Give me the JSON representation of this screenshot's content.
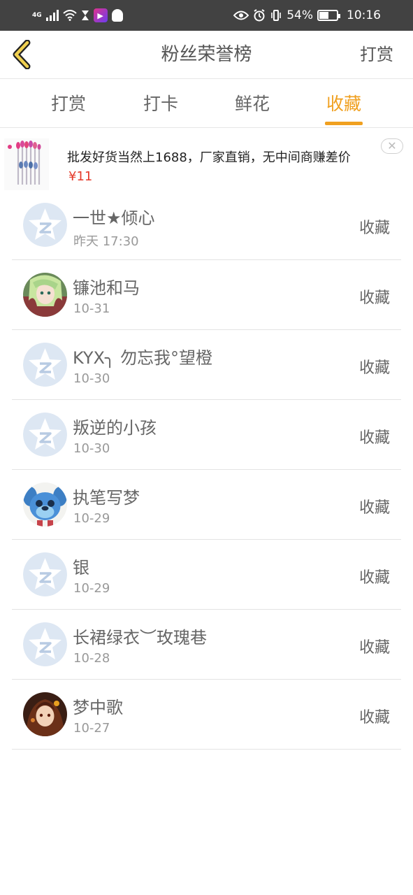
{
  "status_bar": {
    "signal": "4G",
    "battery": "54%",
    "battery_level": 0.54,
    "time": "10:16"
  },
  "header": {
    "title": "粉丝荣誉榜",
    "action_label": "打赏"
  },
  "tabs": [
    {
      "label": "打赏",
      "active": false
    },
    {
      "label": "打卡",
      "active": false
    },
    {
      "label": "鲜花",
      "active": false
    },
    {
      "label": "收藏",
      "active": true
    }
  ],
  "ad": {
    "text": "批发好货当然上1688，厂家直销，无中间商赚差价",
    "price": "¥11",
    "close_icon": "close-icon"
  },
  "list": [
    {
      "name": "一世★倾心",
      "date": "昨天 17:30",
      "action": "收藏",
      "avatar": "default"
    },
    {
      "name": "镰池和马",
      "date": "10-31",
      "action": "收藏",
      "avatar": "anime-green"
    },
    {
      "name": "KYX╮ 勿忘我°望橙",
      "date": "10-30",
      "action": "收藏",
      "avatar": "default"
    },
    {
      "name": "叛逆的小孩",
      "date": "10-30",
      "action": "收藏",
      "avatar": "default"
    },
    {
      "name": "执笔写梦",
      "date": "10-29",
      "action": "收藏",
      "avatar": "blue-creature"
    },
    {
      "name": "银",
      "date": "10-29",
      "action": "收藏",
      "avatar": "default"
    },
    {
      "name": "长裙绿衣︶玫瑰巷",
      "date": "10-28",
      "action": "收藏",
      "avatar": "default"
    },
    {
      "name": "梦中歌",
      "date": "10-27",
      "action": "收藏",
      "avatar": "anime-dark"
    }
  ],
  "colors": {
    "accent": "#f0a020",
    "price": "#e53a2a",
    "status_bar": "#424242"
  }
}
